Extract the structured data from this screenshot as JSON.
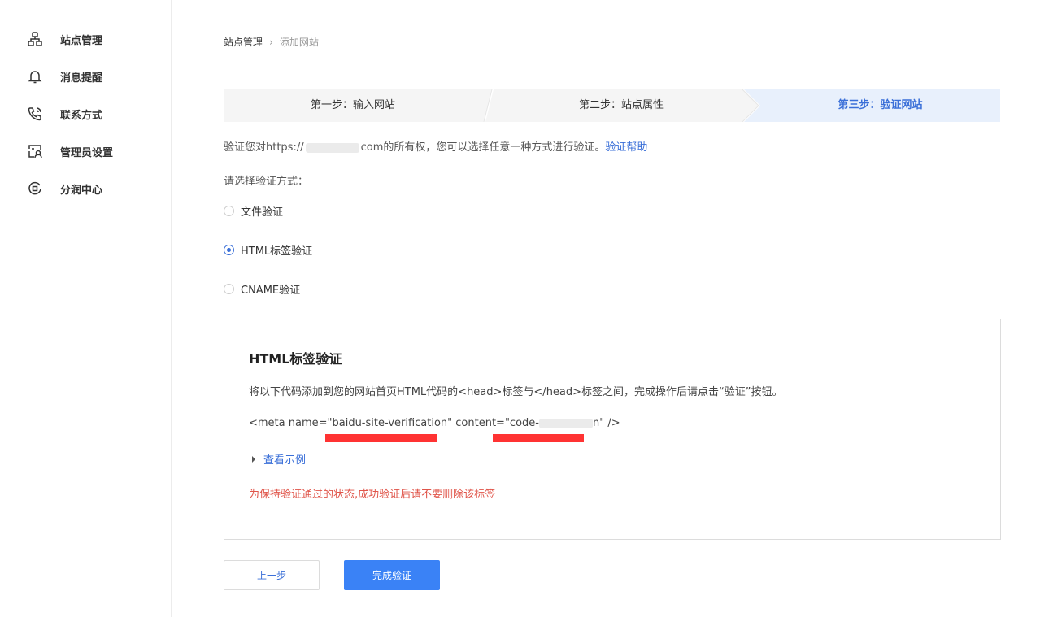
{
  "sidebar": {
    "items": [
      {
        "label": "站点管理",
        "icon": "sitemap-icon"
      },
      {
        "label": "消息提醒",
        "icon": "bell-icon"
      },
      {
        "label": "联系方式",
        "icon": "phone-icon"
      },
      {
        "label": "管理员设置",
        "icon": "admin-user-icon"
      },
      {
        "label": "分润中心",
        "icon": "revenue-icon"
      }
    ]
  },
  "breadcrumb": {
    "root": "站点管理",
    "separator": "›",
    "current": "添加网站"
  },
  "steps": [
    {
      "label": "第一步：输入网站",
      "active": false
    },
    {
      "label": "第二步：站点属性",
      "active": false
    },
    {
      "label": "第三步：验证网站",
      "active": true
    }
  ],
  "description": {
    "prefix": "验证您对https://",
    "masked_part": "",
    "suffix": "com的所有权，您可以选择任意一种方式进行验证。",
    "help_link": "验证帮助"
  },
  "choose_label": "请选择验证方式：",
  "methods": [
    {
      "label": "文件验证",
      "selected": false
    },
    {
      "label": "HTML标签验证",
      "selected": true
    },
    {
      "label": "CNAME验证",
      "selected": false
    }
  ],
  "panel": {
    "title": "HTML标签验证",
    "instruction": "将以下代码添加到您的网站首页HTML代码的<head>标签与</head>标签之间，完成操作后请点击“验证”按钮。",
    "code_prefix": "<meta name=\"baidu-site-verification\" content=\"code-",
    "code_suffix": "n\" />",
    "example_link": "查看示例",
    "warning": "为保持验证通过的状态,成功验证后请不要删除该标签"
  },
  "buttons": {
    "prev": "上一步",
    "done": "完成验证"
  },
  "colors": {
    "accent": "#3a6fd8",
    "primary_button": "#3a82f6",
    "warning": "#e0554a",
    "annotation": "#ff3333",
    "active_step_bg": "#e8f0fc"
  }
}
